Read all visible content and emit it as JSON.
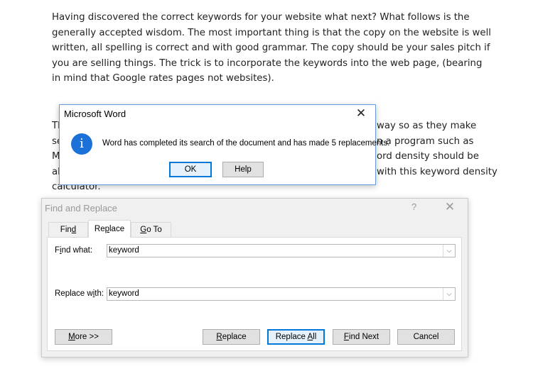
{
  "document": {
    "paragraph1": "Having discovered the correct keywords for your website what next? What follows is the generally accepted wisdom. The most important thing is that the copy on the website is well written, all spelling is correct and with good grammar. The copy should be your sales pitch if you are selling things. The trick is to incorporate the keywords into the web page, (bearing in mind that Google rates pages not websites).",
    "paragraph2_lines": [
      {
        "left": "Th",
        "right": "way so as they make"
      },
      {
        "left": "se",
        "right": "n a program such as"
      },
      {
        "left": "M",
        "right": "ord density should be"
      },
      {
        "left": "ab",
        "right": "with this keyword density"
      },
      {
        "left": "calculator.",
        "right": ""
      }
    ]
  },
  "message_box": {
    "title": "Microsoft Word",
    "close_glyph": "✕",
    "icon_glyph": "i",
    "message": "Word has completed its search of the document and has made 5 replacements.",
    "ok_label": "OK",
    "help_label": "Help"
  },
  "find_replace": {
    "title": "Find and Replace",
    "help_glyph": "?",
    "close_glyph": "✕",
    "tabs": [
      {
        "pre": "Fin",
        "key": "d",
        "post": ""
      },
      {
        "pre": "Re",
        "key": "p",
        "post": "lace"
      },
      {
        "pre": "",
        "key": "G",
        "post": "o To"
      }
    ],
    "find_label_pre": "F",
    "find_label_key": "i",
    "find_label_post": "nd what:",
    "find_value": "keyword",
    "replace_label_pre": "Replace w",
    "replace_label_key": "i",
    "replace_label_post": "th:",
    "replace_value": "keyword",
    "arrow_glyph": "⌵",
    "buttons": {
      "more": {
        "pre": "",
        "key": "M",
        "post": "ore >>"
      },
      "replace": {
        "pre": "",
        "key": "R",
        "post": "eplace"
      },
      "replace_all": {
        "pre": "Replace ",
        "key": "A",
        "post": "ll"
      },
      "find_next": {
        "pre": "",
        "key": "F",
        "post": "ind Next"
      },
      "cancel": {
        "pre": "Cancel",
        "key": "",
        "post": ""
      }
    }
  }
}
